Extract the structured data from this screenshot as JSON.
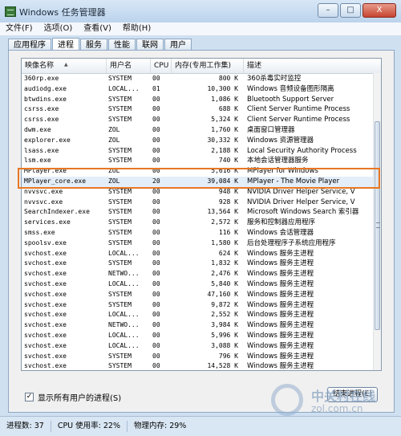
{
  "window": {
    "title": "Windows 任务管理器",
    "controls": {
      "min": "–",
      "max": "□",
      "close": "X"
    }
  },
  "menu": [
    "文件(F)",
    "选项(O)",
    "查看(V)",
    "帮助(H)"
  ],
  "tabs": [
    "应用程序",
    "进程",
    "服务",
    "性能",
    "联网",
    "用户"
  ],
  "columns": {
    "name": "映像名称",
    "user": "用户名",
    "cpu": "CPU",
    "mem": "内存(专用工作集)",
    "desc": "描述"
  },
  "processes": [
    {
      "name": "360rp.exe",
      "user": "SYSTEM",
      "cpu": "00",
      "mem": "800 K",
      "desc": "360杀毒实时监控"
    },
    {
      "name": "audiodg.exe",
      "user": "LOCAL...",
      "cpu": "01",
      "mem": "10,300 K",
      "desc": "Windows 音频设备图形隔离"
    },
    {
      "name": "btwdins.exe",
      "user": "SYSTEM",
      "cpu": "00",
      "mem": "1,086 K",
      "desc": "Bluetooth Support Server"
    },
    {
      "name": "csrss.exe",
      "user": "SYSTEM",
      "cpu": "00",
      "mem": "688 K",
      "desc": "Client Server Runtime Process"
    },
    {
      "name": "csrss.exe",
      "user": "SYSTEM",
      "cpu": "00",
      "mem": "5,324 K",
      "desc": "Client Server Runtime Process"
    },
    {
      "name": "dwm.exe",
      "user": "ZOL",
      "cpu": "00",
      "mem": "1,760 K",
      "desc": "桌面窗口管理器"
    },
    {
      "name": "explorer.exe",
      "user": "ZOL",
      "cpu": "00",
      "mem": "30,332 K",
      "desc": "Windows 资源管理器"
    },
    {
      "name": "lsass.exe",
      "user": "SYSTEM",
      "cpu": "00",
      "mem": "2,188 K",
      "desc": "Local Security Authority Process"
    },
    {
      "name": "lsm.exe",
      "user": "SYSTEM",
      "cpu": "00",
      "mem": "740 K",
      "desc": "本地会话管理器服务"
    },
    {
      "name": "MPlayer.exe",
      "user": "ZOL",
      "cpu": "00",
      "mem": "5,616 K",
      "desc": "MPlayer for Windows"
    },
    {
      "name": "MPlayer_core.exe",
      "user": "ZOL",
      "cpu": "20",
      "mem": "39,084 K",
      "desc": "MPlayer - The Movie Player"
    },
    {
      "name": "nvvsvc.exe",
      "user": "SYSTEM",
      "cpu": "00",
      "mem": "948 K",
      "desc": "NVIDIA Driver Helper Service, V"
    },
    {
      "name": "nvvsvc.exe",
      "user": "SYSTEM",
      "cpu": "00",
      "mem": "928 K",
      "desc": "NVIDIA Driver Helper Service, V"
    },
    {
      "name": "SearchIndexer.exe",
      "user": "SYSTEM",
      "cpu": "00",
      "mem": "13,564 K",
      "desc": "Microsoft Windows Search 索引器"
    },
    {
      "name": "services.exe",
      "user": "SYSTEM",
      "cpu": "00",
      "mem": "2,572 K",
      "desc": "服务和控制器应用程序"
    },
    {
      "name": "smss.exe",
      "user": "SYSTEM",
      "cpu": "00",
      "mem": "116 K",
      "desc": "Windows 会话管理器"
    },
    {
      "name": "spoolsv.exe",
      "user": "SYSTEM",
      "cpu": "00",
      "mem": "1,580 K",
      "desc": "后台处理程序子系统应用程序"
    },
    {
      "name": "svchost.exe",
      "user": "LOCAL...",
      "cpu": "00",
      "mem": "624 K",
      "desc": "Windows 服务主进程"
    },
    {
      "name": "svchost.exe",
      "user": "SYSTEM",
      "cpu": "00",
      "mem": "1,832 K",
      "desc": "Windows 服务主进程"
    },
    {
      "name": "svchost.exe",
      "user": "NETWO...",
      "cpu": "00",
      "mem": "2,476 K",
      "desc": "Windows 服务主进程"
    },
    {
      "name": "svchost.exe",
      "user": "LOCAL...",
      "cpu": "00",
      "mem": "5,840 K",
      "desc": "Windows 服务主进程"
    },
    {
      "name": "svchost.exe",
      "user": "SYSTEM",
      "cpu": "00",
      "mem": "47,160 K",
      "desc": "Windows 服务主进程"
    },
    {
      "name": "svchost.exe",
      "user": "SYSTEM",
      "cpu": "00",
      "mem": "9,872 K",
      "desc": "Windows 服务主进程"
    },
    {
      "name": "svchost.exe",
      "user": "LOCAL...",
      "cpu": "00",
      "mem": "2,552 K",
      "desc": "Windows 服务主进程"
    },
    {
      "name": "svchost.exe",
      "user": "NETWO...",
      "cpu": "00",
      "mem": "3,984 K",
      "desc": "Windows 服务主进程"
    },
    {
      "name": "svchost.exe",
      "user": "LOCAL...",
      "cpu": "00",
      "mem": "5,996 K",
      "desc": "Windows 服务主进程"
    },
    {
      "name": "svchost.exe",
      "user": "LOCAL...",
      "cpu": "00",
      "mem": "3,088 K",
      "desc": "Windows 服务主进程"
    },
    {
      "name": "svchost.exe",
      "user": "SYSTEM",
      "cpu": "00",
      "mem": "796 K",
      "desc": "Windows 服务主进程"
    },
    {
      "name": "svchost.exe",
      "user": "SYSTEM",
      "cpu": "00",
      "mem": "14,528 K",
      "desc": "Windows 服务主进程"
    }
  ],
  "show_all_label": "显示所有用户的进程(S)",
  "end_process_label": "结束进程(E)",
  "watermark": {
    "line1": "中关村在线",
    "line2": "zol.com.cn"
  },
  "status": {
    "processes": "进程数: 37",
    "cpu": "CPU 使用率: 22%",
    "memory": "物理内存: 29%"
  },
  "colors": {
    "highlight": "#e87722",
    "titlebar": "#bcd3ec"
  }
}
